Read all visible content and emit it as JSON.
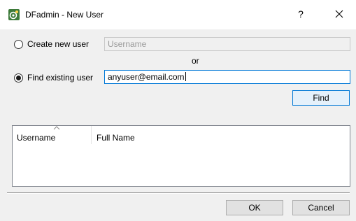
{
  "window": {
    "title": "DFadmin - New User",
    "help_label": "?"
  },
  "create": {
    "label": "Create new user",
    "placeholder": "Username",
    "selected": false
  },
  "or_label": "or",
  "find": {
    "label": "Find existing user",
    "value": "anyuser@email.com",
    "selected": true,
    "button_label": "Find"
  },
  "results_table": {
    "columns": [
      "Username",
      "Full Name"
    ],
    "sort_column": "Username",
    "rows": []
  },
  "footer": {
    "ok_label": "OK",
    "cancel_label": "Cancel"
  }
}
